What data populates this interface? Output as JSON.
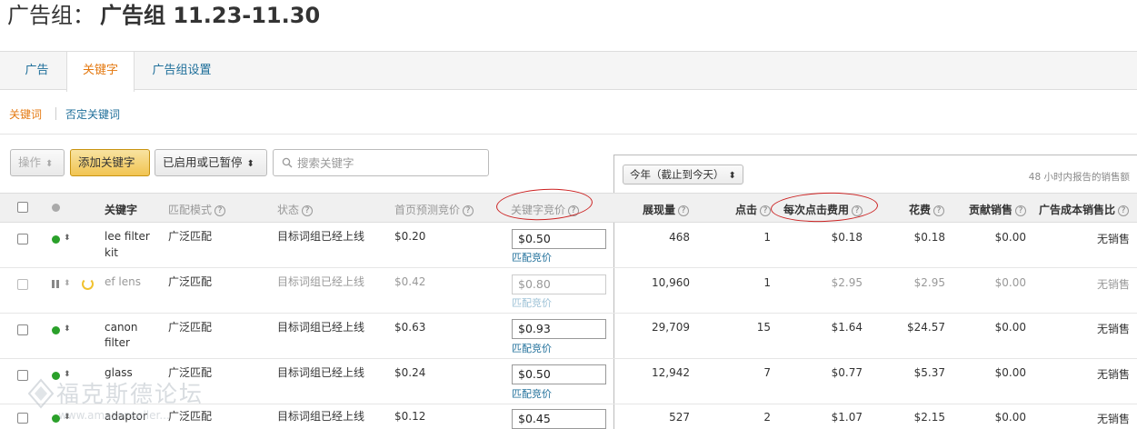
{
  "header": {
    "prefix": "广告组：",
    "name": "广告组 11.23-11.30"
  },
  "tabs": [
    {
      "label": "广告"
    },
    {
      "label": "关键字",
      "active": true
    },
    {
      "label": "广告组设置"
    }
  ],
  "subnav": {
    "active": "关键词",
    "link": "否定关键词"
  },
  "toolbar": {
    "action_label": "操作",
    "add_label": "添加关键字",
    "filter_label": "已启用或已暂停",
    "search_placeholder": "搜索关键字"
  },
  "report": {
    "range_label": "今年（截止到今天）",
    "note": "48 小时内报告的销售额"
  },
  "columns": {
    "keyword": "关键字",
    "match": "匹配模式",
    "status": "状态",
    "suggested_bid": "首页预测竞价",
    "keyword_bid": "关键字竞价",
    "impressions": "展现量",
    "clicks": "点击",
    "cpc": "每次点击费用",
    "spend": "花费",
    "sales": "贡献销售",
    "acos": "广告成本销售比"
  },
  "rows": [
    {
      "keyword": "lee filter",
      "keyword2": "kit",
      "state": "active",
      "match": "广泛匹配",
      "status": "目标词组已经上线",
      "suggested": "$0.20",
      "bid": "$0.50",
      "bid_link": "匹配竞价",
      "impressions": "468",
      "clicks": "1",
      "cpc": "$0.18",
      "spend": "$0.18",
      "sales": "$0.00",
      "acos": "无销售"
    },
    {
      "keyword": "ef lens",
      "keyword2": "",
      "state": "paused",
      "match": "广泛匹配",
      "status": "目标词组已经上线",
      "suggested": "$0.42",
      "bid": "$0.80",
      "bid_link": "匹配竞价",
      "impressions": "10,960",
      "clicks": "1",
      "cpc": "$2.95",
      "spend": "$2.95",
      "sales": "$0.00",
      "acos": "无销售"
    },
    {
      "keyword": "canon",
      "keyword2": "filter",
      "state": "active",
      "match": "广泛匹配",
      "status": "目标词组已经上线",
      "suggested": "$0.63",
      "bid": "$0.93",
      "bid_link": "匹配竞价",
      "impressions": "29,709",
      "clicks": "15",
      "cpc": "$1.64",
      "spend": "$24.57",
      "sales": "$0.00",
      "acos": "无销售"
    },
    {
      "keyword": "glass",
      "keyword2": "",
      "state": "active",
      "match": "广泛匹配",
      "status": "目标词组已经上线",
      "suggested": "$0.24",
      "bid": "$0.50",
      "bid_link": "匹配竞价",
      "impressions": "12,942",
      "clicks": "7",
      "cpc": "$0.77",
      "spend": "$5.37",
      "sales": "$0.00",
      "acos": "无销售"
    },
    {
      "keyword": "adaptor",
      "keyword2": "",
      "state": "active",
      "match": "广泛匹配",
      "status": "目标词组已经上线",
      "suggested": "$0.12",
      "bid": "$0.45",
      "bid_link": "",
      "impressions": "527",
      "clicks": "2",
      "cpc": "$1.07",
      "spend": "$2.15",
      "sales": "$0.00",
      "acos": "无销售"
    }
  ],
  "watermark": {
    "text": "福克斯德论坛",
    "url": "www.amazonseller..."
  },
  "colors": {
    "accent": "#e47911",
    "link": "#1f6f9a",
    "active_dot": "#2aa02a",
    "annotation": "#cc2222"
  }
}
